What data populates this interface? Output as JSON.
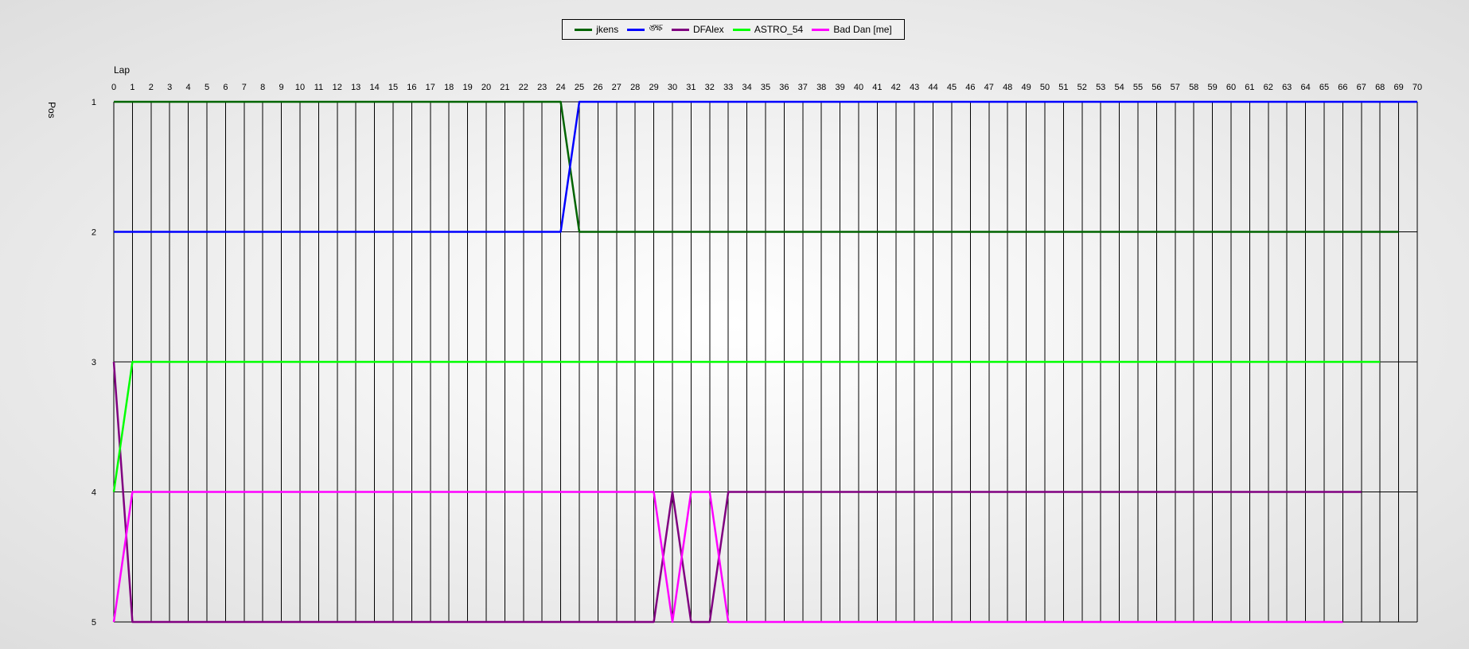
{
  "chart_data": {
    "type": "line",
    "xlabel": "Lap",
    "ylabel": "Pos",
    "x": [
      0,
      1,
      2,
      3,
      4,
      5,
      6,
      7,
      8,
      9,
      10,
      11,
      12,
      13,
      14,
      15,
      16,
      17,
      18,
      19,
      20,
      21,
      22,
      23,
      24,
      25,
      26,
      27,
      28,
      29,
      30,
      31,
      32,
      33,
      34,
      35,
      36,
      37,
      38,
      39,
      40,
      41,
      42,
      43,
      44,
      45,
      46,
      47,
      48,
      49,
      50,
      51,
      52,
      53,
      54,
      55,
      56,
      57,
      58,
      59,
      60,
      61,
      62,
      63,
      64,
      65,
      66,
      67,
      68,
      69,
      70
    ],
    "xlim": [
      0,
      70
    ],
    "ylim": [
      1,
      5
    ],
    "y_ticks": [
      1,
      2,
      3,
      4,
      5
    ],
    "y_inverted": true,
    "grid": "vertical lines at every lap, horizontal lines at every position",
    "legend_placement": "top-center",
    "series": [
      {
        "name": "jkens",
        "color": "#006400",
        "segments": [
          {
            "x": [
              0,
              24
            ],
            "y": [
              1,
              1
            ]
          },
          {
            "x": [
              24,
              25
            ],
            "y": [
              1,
              2
            ]
          },
          {
            "x": [
              25,
              69
            ],
            "y": [
              2,
              2
            ]
          }
        ]
      },
      {
        "name": "ঙ্ক্ষ",
        "color": "#0000ff",
        "segments": [
          {
            "x": [
              0,
              24
            ],
            "y": [
              2,
              2
            ]
          },
          {
            "x": [
              24,
              25
            ],
            "y": [
              2,
              1
            ]
          },
          {
            "x": [
              25,
              70
            ],
            "y": [
              1,
              1
            ]
          }
        ]
      },
      {
        "name": "DFAlex",
        "color": "#800080",
        "points": [
          [
            0,
            3
          ],
          [
            1,
            5
          ],
          [
            29,
            5
          ],
          [
            30,
            4
          ],
          [
            31,
            5
          ],
          [
            32,
            5
          ],
          [
            33,
            4
          ],
          [
            67,
            4
          ]
        ]
      },
      {
        "name": "ASTRO_54",
        "color": "#00ff00",
        "points": [
          [
            0,
            4
          ],
          [
            1,
            3
          ],
          [
            68,
            3
          ]
        ]
      },
      {
        "name": "Bad Dan [me]",
        "color": "#ff00ff",
        "points": [
          [
            0,
            5
          ],
          [
            1,
            4
          ],
          [
            29,
            4
          ],
          [
            30,
            5
          ],
          [
            31,
            4
          ],
          [
            32,
            4
          ],
          [
            33,
            5
          ],
          [
            66,
            5
          ]
        ]
      }
    ]
  }
}
